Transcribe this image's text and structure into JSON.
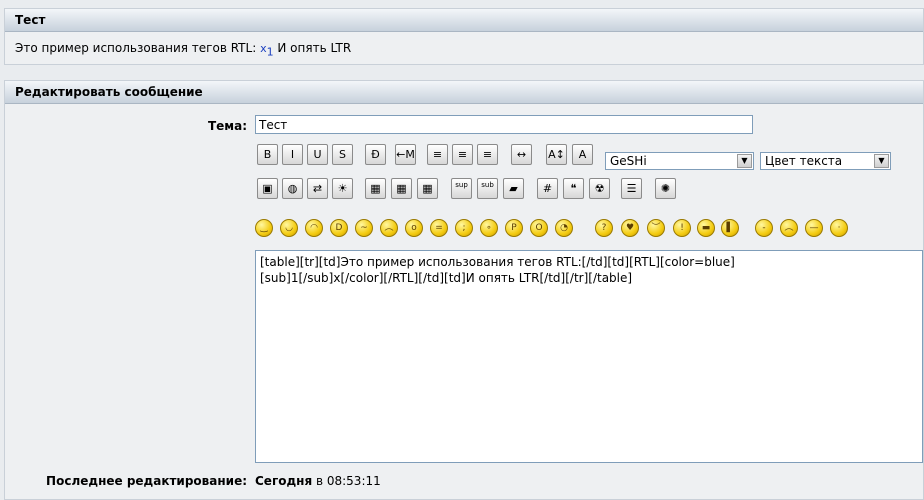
{
  "preview": {
    "title": "Тест",
    "text_before": "Это пример использования тегов RTL: ",
    "sub_base": "x",
    "sub_index": "1",
    "text_after": " И опять LTR"
  },
  "editor": {
    "title": "Редактировать сообщение",
    "subject_label": "Тема:",
    "subject_value": "Тест",
    "toolbar_row1": [
      {
        "name": "bold-button",
        "label": "B"
      },
      {
        "name": "italic-button",
        "label": "I"
      },
      {
        "name": "underline-button",
        "label": "U"
      },
      {
        "name": "strike-button",
        "label": "S"
      },
      {
        "name": "bidi-button",
        "label": "Ð"
      },
      {
        "name": "rtl-button",
        "label": "←M"
      },
      {
        "name": "align-left-button",
        "label": "≡"
      },
      {
        "name": "align-center-button",
        "label": "≡"
      },
      {
        "name": "align-right-button",
        "label": "≡"
      },
      {
        "name": "hr-button",
        "label": "↔"
      },
      {
        "name": "font-size-button",
        "label": "A↕"
      },
      {
        "name": "font-color-button",
        "label": "A"
      }
    ],
    "geshi_select": "GeSHi",
    "color_select": "Цвет текста",
    "toolbar_row2": [
      {
        "name": "image-button",
        "label": "▣"
      },
      {
        "name": "web-link-button",
        "label": "◍"
      },
      {
        "name": "email-button",
        "label": "⇄"
      },
      {
        "name": "flash-button",
        "label": "☀"
      },
      {
        "name": "table-button",
        "label": "▦"
      },
      {
        "name": "table-row-button",
        "label": "▦"
      },
      {
        "name": "table-cell-button",
        "label": "▦"
      },
      {
        "name": "sup-button",
        "label": "sup"
      },
      {
        "name": "sub-button",
        "label": "sub"
      },
      {
        "name": "code-button",
        "label": "▰"
      },
      {
        "name": "hash-button",
        "label": "#"
      },
      {
        "name": "quote-button",
        "label": "❝"
      },
      {
        "name": "radioactive-button",
        "label": "☢"
      },
      {
        "name": "list-button",
        "label": "☰"
      },
      {
        "name": "color-wheel-button",
        "label": "✺"
      }
    ],
    "smilies": [
      {
        "name": "smile-icon",
        "glyph": "‿"
      },
      {
        "name": "grin-icon",
        "glyph": "◡"
      },
      {
        "name": "laugh-icon",
        "glyph": "◠"
      },
      {
        "name": "biggrin-icon",
        "glyph": "D"
      },
      {
        "name": "annoyed-icon",
        "glyph": "~"
      },
      {
        "name": "sad-icon",
        "glyph": "︵"
      },
      {
        "name": "surprised-icon",
        "glyph": "o"
      },
      {
        "name": "cool-icon",
        "glyph": "="
      },
      {
        "name": "wink-icon",
        "glyph": ";"
      },
      {
        "name": "eyes-icon",
        "glyph": "∘"
      },
      {
        "name": "tongue-icon",
        "glyph": "P"
      },
      {
        "name": "shocked-icon",
        "glyph": "O"
      },
      {
        "name": "rolleyes-icon",
        "glyph": "◔"
      },
      {
        "name": "confused-icon",
        "glyph": "?"
      },
      {
        "name": "love-icon",
        "glyph": "♥"
      },
      {
        "name": "worried-icon",
        "glyph": "︶"
      },
      {
        "name": "angry-icon",
        "glyph": "!"
      },
      {
        "name": "ninja-icon",
        "glyph": "▬"
      },
      {
        "name": "wall-icon",
        "glyph": "▌"
      },
      {
        "name": "hmm-icon",
        "glyph": "-"
      },
      {
        "name": "unhappy-icon",
        "glyph": "︵"
      },
      {
        "name": "neutral-icon",
        "glyph": "—"
      },
      {
        "name": "doubt-icon",
        "glyph": "·"
      }
    ],
    "message_line1": "[table][tr][td]Это пример использования тегов RTL:[/td][td][RTL][color=blue]",
    "message_line2": "[sub]1[/sub]x[/color][/RTL][/td][td]И опять LTR[/td][/tr][/table]",
    "last_edit_label": "Последнее редактирование:",
    "last_edit_day": "Сегодня",
    "last_edit_in": " в ",
    "last_edit_time": "08:53:11"
  }
}
